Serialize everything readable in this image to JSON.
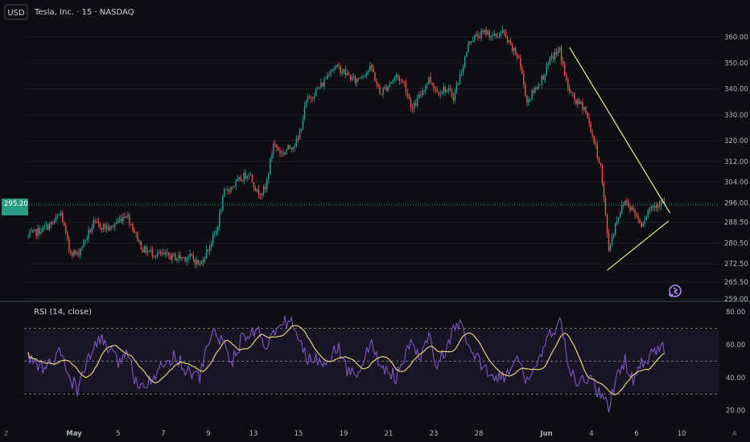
{
  "header": {
    "currency": "USD",
    "symbol_title": "Tesla, Inc. · 15 · NASDAQ"
  },
  "price_tag": {
    "value": "295.20",
    "countdown": "    "
  },
  "indicator": {
    "label": "RSI (14, close)"
  },
  "footer": {
    "left_icon": "Z",
    "right_icon": "A"
  },
  "colors": {
    "background": "#0d0e12",
    "up": "#26a69a",
    "down": "#ef5350",
    "rsi_line": "#7e57c2",
    "rsi_ma": "#f7e082",
    "trendline": "#f2e6a0",
    "price_tag_bg": "#2a9a82"
  },
  "icons": {
    "replay": "replay-icon"
  },
  "chart_data": [
    {
      "type": "candlestick",
      "x_ticks": [
        "May",
        "5",
        "7",
        "9",
        "13",
        "15",
        "19",
        "21",
        "23",
        "28",
        "Jun",
        "4",
        "6",
        "10"
      ],
      "y_ticks": [
        259.0,
        265.5,
        272.5,
        280.5,
        288.5,
        296.0,
        304.0,
        312.0,
        320.0,
        330.0,
        340.0,
        350.0,
        360.0
      ],
      "y_tick_labels": [
        "259.00",
        "265.50",
        "272.50",
        "280.50",
        "288.50",
        "296.00",
        "304.00",
        "312.00",
        "320.00",
        "330.00",
        "340.00",
        "350.00",
        "360.00"
      ],
      "ylim": [
        258.0,
        365.0
      ],
      "current_price": 295.2,
      "path": [
        [
          0,
          283
        ],
        [
          3,
          288
        ],
        [
          4,
          292
        ],
        [
          5,
          278
        ],
        [
          6,
          276
        ],
        [
          8,
          288
        ],
        [
          10,
          286
        ],
        [
          12,
          292
        ],
        [
          14,
          278
        ],
        [
          16,
          276
        ],
        [
          18,
          275
        ],
        [
          20,
          275
        ],
        [
          21,
          272
        ],
        [
          23,
          285
        ],
        [
          24,
          300
        ],
        [
          26,
          305
        ],
        [
          27,
          308
        ],
        [
          28,
          300
        ],
        [
          29,
          301
        ],
        [
          30,
          319
        ],
        [
          31,
          315
        ],
        [
          33,
          320
        ],
        [
          34,
          335
        ],
        [
          36,
          342
        ],
        [
          37,
          348
        ],
        [
          38,
          348
        ],
        [
          40,
          343
        ],
        [
          41,
          346
        ],
        [
          42,
          348
        ],
        [
          43,
          338
        ],
        [
          45,
          345
        ],
        [
          46,
          342
        ],
        [
          47,
          332
        ],
        [
          49,
          344
        ],
        [
          50,
          339
        ],
        [
          51,
          340
        ],
        [
          52,
          337
        ],
        [
          53,
          347
        ],
        [
          54,
          359
        ],
        [
          56,
          362
        ],
        [
          57,
          360
        ],
        [
          58,
          362
        ],
        [
          59,
          356
        ],
        [
          60,
          352
        ],
        [
          61,
          335
        ],
        [
          63,
          345
        ],
        [
          64,
          352
        ],
        [
          65,
          355
        ],
        [
          66,
          340
        ],
        [
          67,
          335
        ],
        [
          68,
          333
        ],
        [
          69,
          322
        ],
        [
          70,
          310
        ],
        [
          71,
          278
        ],
        [
          72,
          290
        ],
        [
          73,
          297
        ],
        [
          74,
          293
        ],
        [
          75,
          288
        ],
        [
          76,
          294
        ],
        [
          77,
          296
        ]
      ],
      "trendlines": [
        {
          "from": [
            66.2,
            356
          ],
          "to": [
            78.5,
            292
          ]
        },
        {
          "from": [
            70.8,
            270
          ],
          "to": [
            78.3,
            289
          ]
        }
      ]
    },
    {
      "type": "line",
      "name": "RSI (14, close)",
      "y_ticks": [
        20,
        40,
        60,
        80
      ],
      "y_tick_labels": [
        "20.00",
        "40.00",
        "60.00",
        "80.00"
      ],
      "ylim": [
        13,
        84
      ],
      "bands": [
        30,
        50,
        70
      ],
      "path": [
        [
          0,
          52
        ],
        [
          2,
          45
        ],
        [
          4,
          55
        ],
        [
          5,
          40
        ],
        [
          6,
          33
        ],
        [
          8,
          58
        ],
        [
          9,
          64
        ],
        [
          11,
          48
        ],
        [
          12,
          58
        ],
        [
          13,
          40
        ],
        [
          14,
          36
        ],
        [
          16,
          44
        ],
        [
          18,
          55
        ],
        [
          19,
          46
        ],
        [
          21,
          40
        ],
        [
          22,
          62
        ],
        [
          23,
          68
        ],
        [
          25,
          50
        ],
        [
          26,
          62
        ],
        [
          28,
          70
        ],
        [
          29,
          60
        ],
        [
          31,
          72
        ],
        [
          32,
          76
        ],
        [
          33,
          64
        ],
        [
          34,
          52
        ],
        [
          36,
          50
        ],
        [
          38,
          58
        ],
        [
          39,
          44
        ],
        [
          40,
          42
        ],
        [
          42,
          60
        ],
        [
          43,
          48
        ],
        [
          45,
          40
        ],
        [
          47,
          62
        ],
        [
          48,
          50
        ],
        [
          49,
          66
        ],
        [
          50,
          46
        ],
        [
          52,
          68
        ],
        [
          53,
          72
        ],
        [
          54,
          56
        ],
        [
          56,
          45
        ],
        [
          58,
          40
        ],
        [
          60,
          50
        ],
        [
          61,
          38
        ],
        [
          63,
          56
        ],
        [
          64,
          68
        ],
        [
          65,
          74
        ],
        [
          66,
          50
        ],
        [
          67,
          34
        ],
        [
          68,
          40
        ],
        [
          69,
          38
        ],
        [
          70,
          28
        ],
        [
          71,
          22
        ],
        [
          72,
          42
        ],
        [
          73,
          50
        ],
        [
          74,
          38
        ],
        [
          75,
          48
        ],
        [
          76,
          52
        ],
        [
          77,
          58
        ]
      ]
    }
  ]
}
